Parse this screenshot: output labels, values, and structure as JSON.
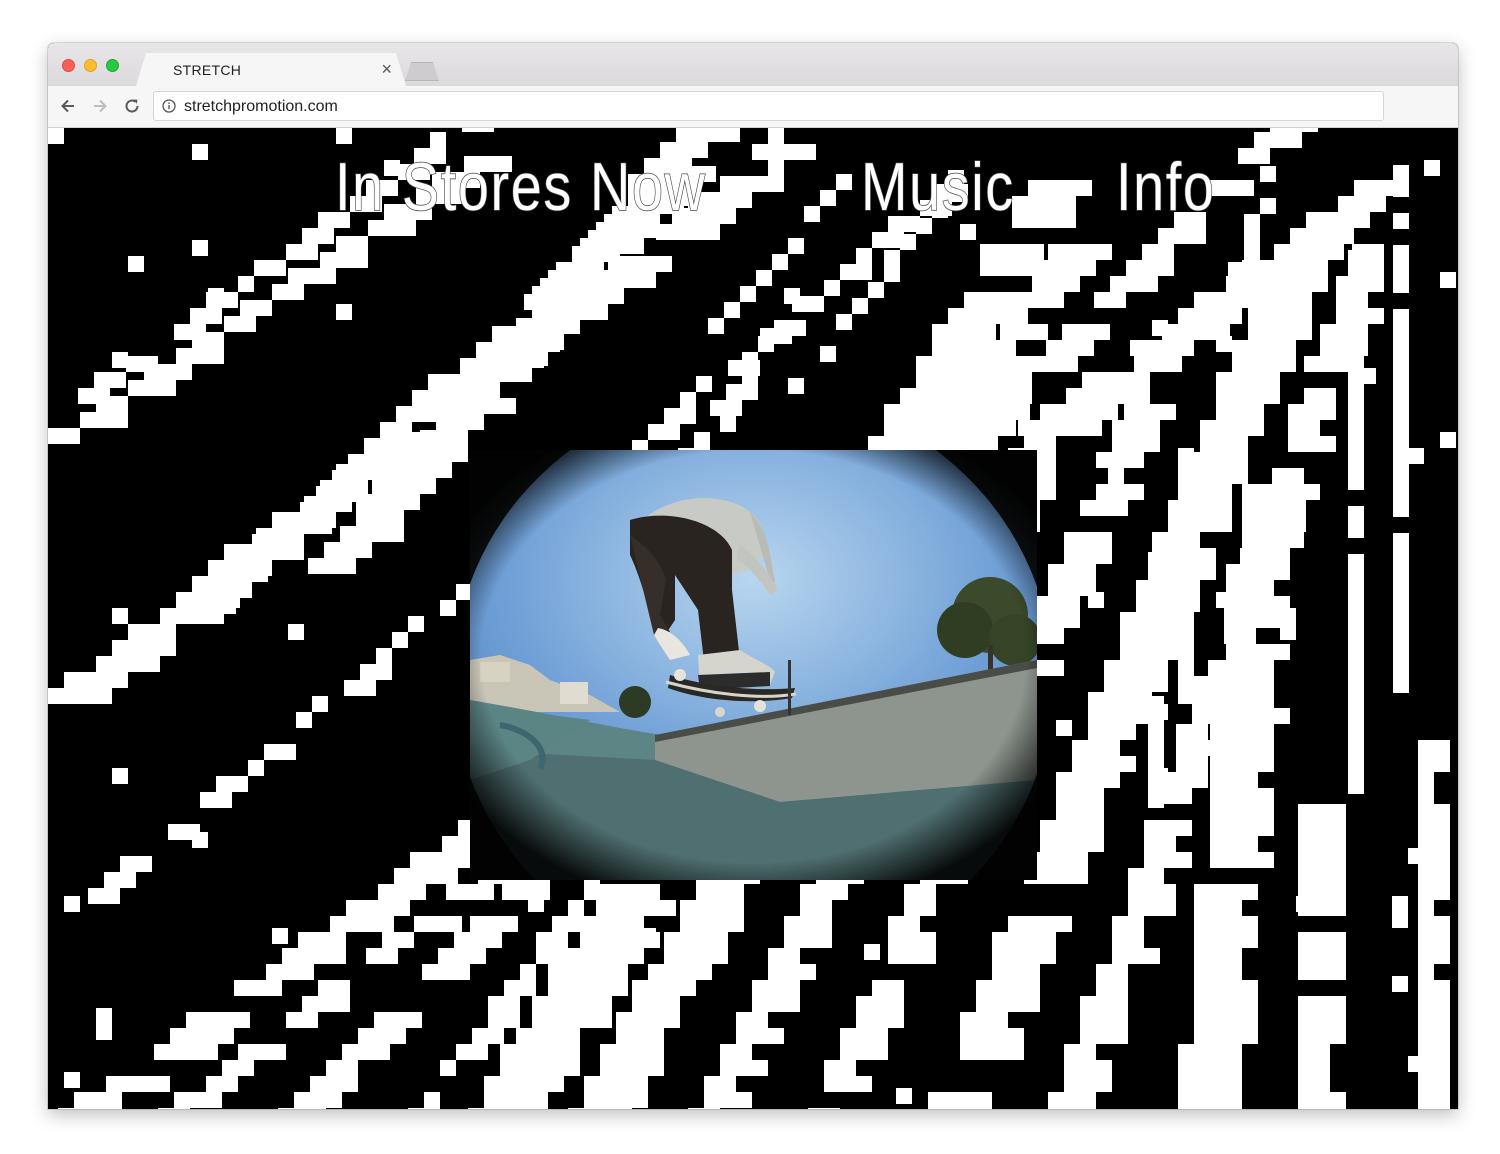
{
  "browser": {
    "tab_title": "STRETCH",
    "tab_close": "×",
    "address": "stretchpromotion.com"
  },
  "nav": {
    "items": [
      {
        "label": "In Stores Now"
      },
      {
        "label": "Music"
      },
      {
        "label": "Info"
      }
    ]
  },
  "colors": {
    "background": "#000000",
    "pattern": "#ffffff",
    "nav_text": "#ffffff"
  },
  "icons": {
    "back": "arrow-left-icon",
    "forward": "arrow-right-icon",
    "reload": "reload-icon",
    "info": "info-icon",
    "close": "close-icon"
  }
}
